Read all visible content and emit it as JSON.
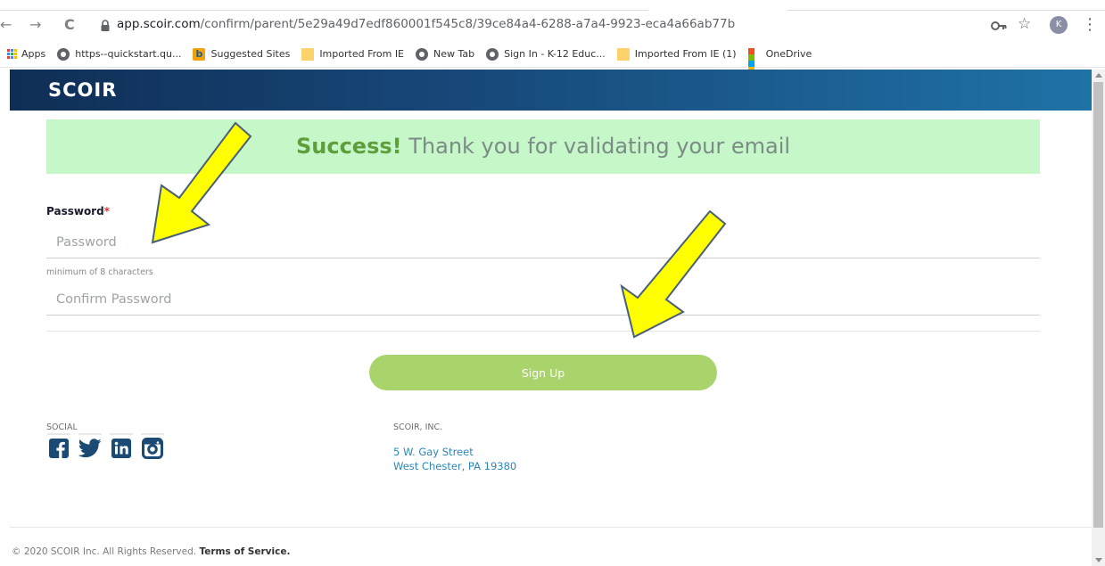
{
  "browser": {
    "url_host": "app.scoir.com",
    "url_path": "/confirm/parent/5e29a49d7edf860001f545c8/39ce84a4-6288-a7a4-9923-eca4a66ab77b",
    "profile_initial": "K",
    "back_glyph": "←",
    "forward_glyph": "→",
    "reload_glyph": "C",
    "star_glyph": "☆",
    "menu_glyph": "⋮",
    "bookmarks": [
      {
        "label": "Apps",
        "icon": "apps-grid-icon"
      },
      {
        "label": "https--quickstart.qu...",
        "icon": "globe-icon"
      },
      {
        "label": "Suggested Sites",
        "icon": "bing-icon"
      },
      {
        "label": "Imported From IE",
        "icon": "folder-icon"
      },
      {
        "label": "New Tab",
        "icon": "globe-icon"
      },
      {
        "label": "Sign In - K-12 Educ...",
        "icon": "globe-icon"
      },
      {
        "label": "Imported From IE (1)",
        "icon": "folder-icon"
      },
      {
        "label": "OneDrive",
        "icon": "microsoft-icon"
      }
    ]
  },
  "header": {
    "logo": "SCOIR",
    "gradient": [
      "#0f2e55",
      "#1f72a6"
    ]
  },
  "banner": {
    "strong": "Success!",
    "message": "Thank you for validating your email",
    "bg": "#c6f7c8"
  },
  "form": {
    "password_label": "Password",
    "required_marker": "*",
    "password_placeholder": "Password",
    "password_hint": "minimum of 8 characters",
    "confirm_placeholder": "Confirm Password",
    "submit_label": "Sign Up",
    "submit_color": "#a9d46b"
  },
  "footer": {
    "social_heading": "SOCIAL",
    "social_icons": [
      "facebook-icon",
      "twitter-icon",
      "linkedin-icon",
      "instagram-icon"
    ],
    "company_heading": "SCOIR, INC.",
    "address_line1": "5 W. Gay Street",
    "address_line2": "West Chester, PA 19380",
    "copyright": "© 2020 SCOIR Inc. All Rights Reserved.",
    "terms": "Terms of Service."
  },
  "annotations": {
    "arrow_color": "#ffff00",
    "arrow_count": 2
  }
}
